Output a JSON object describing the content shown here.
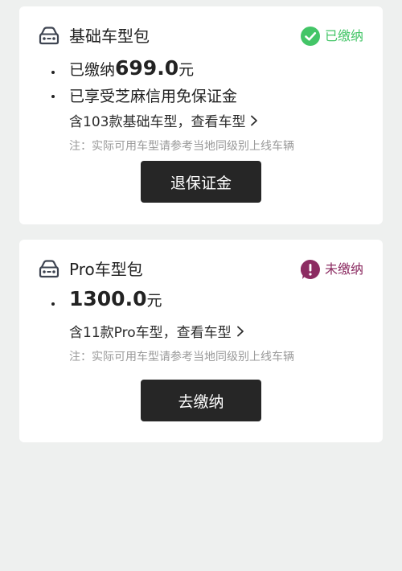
{
  "basic_pack": {
    "title": "基础车型包",
    "status_label": "已缴纳",
    "status_color": "#43c567",
    "status_icon": "check-circle-icon",
    "paid_prefix": "已缴纳",
    "amount": "699.0",
    "unit": "元",
    "zhima_text": "已享受芝麻信用免保证金",
    "models_link": "含103款基础车型，查看车型",
    "note": "注：实际可用车型请参考当地同级别上线车辆",
    "button_label": "退保证金"
  },
  "pro_pack": {
    "title": "Pro车型包",
    "status_label": "未缴纳",
    "status_color": "#8c2c62",
    "status_icon": "exclamation-circle-icon",
    "amount": "1300.0",
    "unit": "元",
    "models_link": "含11款Pro车型，查看车型",
    "note": "注：实际可用车型请参考当地同级别上线车辆",
    "button_label": "去缴纳"
  }
}
